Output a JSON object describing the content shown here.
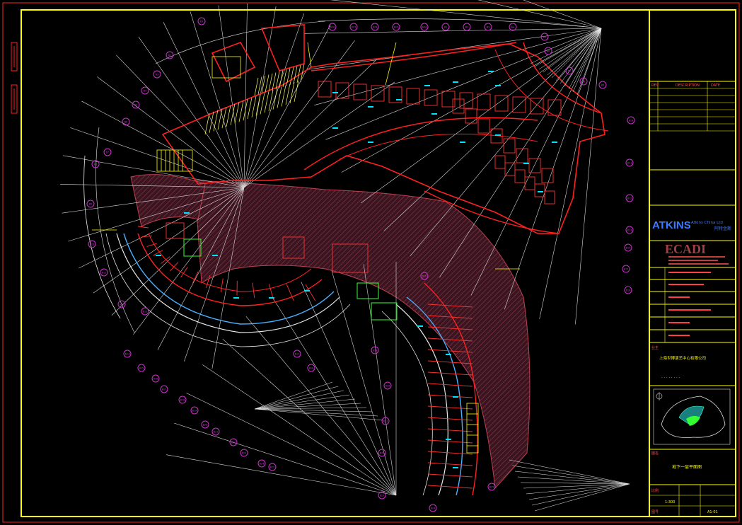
{
  "drawing": {
    "frame_color": "#ffff00",
    "wall_color": "#ff2020",
    "grid_color": "#ffffff",
    "bubble_color": "#cc33cc",
    "label_color": "#00e5ff",
    "hatch_color": "#7a2a3a",
    "stair_color": "#ffff00",
    "equip_color": "#33ff33"
  },
  "grid_bubbles": [
    "B1",
    "B2",
    "B3",
    "B4",
    "B5",
    "B6",
    "B7",
    "B8",
    "B9",
    "B10",
    "B11",
    "B12",
    "B13",
    "B14",
    "B15",
    "B16",
    "B17",
    "B18",
    "B19",
    "B20",
    "B21",
    "B22",
    "B23",
    "B24",
    "B25",
    "B26",
    "B27",
    "B28",
    "B29",
    "B30"
  ],
  "title_block": {
    "revision_header": [
      "REV",
      "DESCRIPTION",
      "DATE"
    ],
    "atkins_logo": "ATKINS",
    "atkins_sub": "Atkins China Ltd",
    "atkins_cn": "阿特金斯",
    "ecadi_logo": "ECADI",
    "owner_label": "业主",
    "owner_value": "上海世博演艺中心有限公司",
    "drawing_name_label": "图名",
    "drawing_name_value": "地下一层平面图",
    "scale_label": "比例",
    "scale_value": "1:300",
    "sheet_label": "图号",
    "sheet_value": "A1-01"
  }
}
